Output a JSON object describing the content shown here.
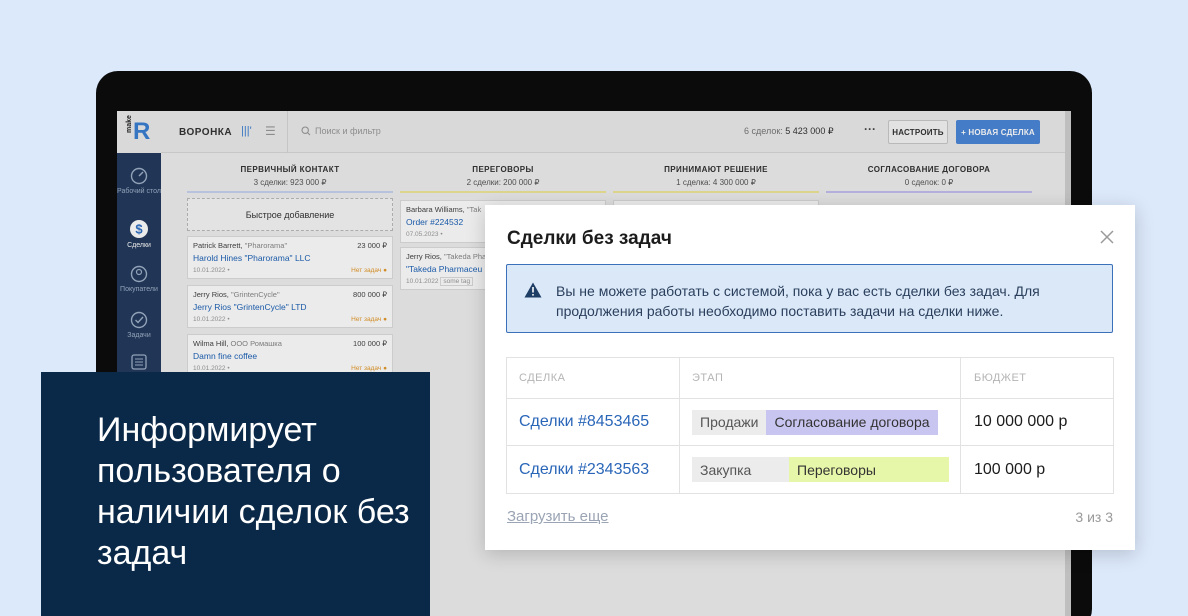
{
  "app": {
    "logo_small": "make",
    "logo_letter": "R",
    "title": "ВОРОНКА",
    "search_placeholder": "Поиск и фильтр",
    "deals_count_label": "6 сделок:",
    "deals_total": "5 423 000 ₽",
    "more_label": "···",
    "configure_label": "НАСТРОИТЬ",
    "new_deal_label": "+ НОВАЯ СДЕЛКА",
    "sidebar": [
      {
        "icon": "dashboard-icon",
        "label": "Рабочий стол"
      },
      {
        "icon": "dollar-icon",
        "label": "Сделки"
      },
      {
        "icon": "customers-icon",
        "label": "Покупатели"
      },
      {
        "icon": "tasks-icon",
        "label": "Задачи"
      },
      {
        "icon": "list-icon",
        "label": ""
      }
    ],
    "columns": [
      {
        "name": "ПЕРВИЧНЫЙ КОНТАКТ",
        "summary": "3 сделки: 923 000 ₽",
        "color": "#c8d3ef"
      },
      {
        "name": "ПЕРЕГОВОРЫ",
        "summary": "2 сделки: 200 000 ₽",
        "color": "#f1e89a"
      },
      {
        "name": "ПРИНИМАЮТ РЕШЕНИЕ",
        "summary": "1 сделка: 4 300 000 ₽",
        "color": "#f1e89a"
      },
      {
        "name": "СОГЛАСОВАНИЕ ДОГОВОРА",
        "summary": "0 сделок: 0 ₽",
        "color": "#c4bff0"
      }
    ],
    "quick_add": "Быстрое добавление",
    "cards_col1": [
      {
        "contact": "Patrick Barrett,",
        "company": "\"Pharorama\"",
        "amount": "23 000 ₽",
        "name": "Harold Hines \"Pharorama\" LLC",
        "date": "10.01.2022",
        "status": "Нет задач"
      },
      {
        "contact": "Jerry Rios,",
        "company": "\"GrintenCycle\"",
        "amount": "800 000 ₽",
        "name": "Jerry Rios \"GrintenCycle\" LTD",
        "date": "10.01.2022",
        "status": "Нет задач"
      },
      {
        "contact": "Wilma Hill,",
        "company": "ООО Ромашка",
        "amount": "100 000 ₽",
        "name": "Damn fine coffee",
        "date": "10.01.2022",
        "status": "Нет задач"
      }
    ],
    "cards_col2": [
      {
        "contact": "Barbara Williams,",
        "company": "\"Tak",
        "name": "Order #224532",
        "date": "07.05.2023"
      },
      {
        "contact": "Jerry Rios,",
        "company": "\"Takeda Pha",
        "name": "\"Takeda Pharmaceu",
        "date": "10.01.2022",
        "tag": "some tag"
      }
    ]
  },
  "info_panel": {
    "text": "Информирует пользователя о наличии сделок без задач"
  },
  "modal": {
    "title": "Сделки без задач",
    "alert": "Вы не можете работать с системой, пока у вас есть сделки без задач. Для продолжения работы необходимо поставить задачи на сделки ниже.",
    "headers": {
      "deal": "СДЕЛКА",
      "stage": "ЭТАП",
      "budget": "БЮДЖЕТ"
    },
    "rows": [
      {
        "deal": "Сделки #8453465",
        "pipeline": "Продажи",
        "stage": "Согласование договора",
        "budget": "10 000 000 р"
      },
      {
        "deal": "Сделки #2343563",
        "pipeline": "Закупка",
        "stage": "Переговоры",
        "budget": "100 000 р"
      }
    ],
    "load_more": "Загрузить еще",
    "count": "3 из 3"
  }
}
